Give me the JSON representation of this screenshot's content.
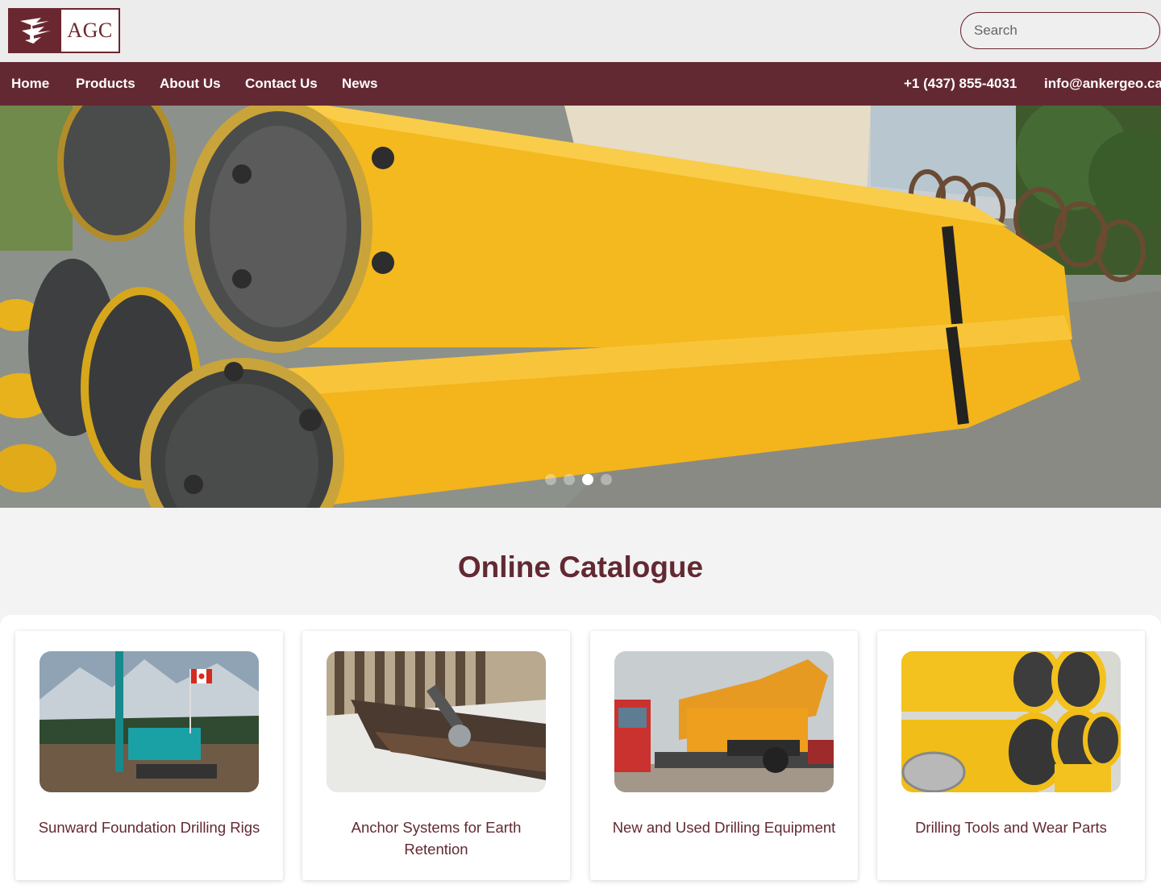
{
  "header": {
    "logo_text": "AGC",
    "search_placeholder": "Search"
  },
  "nav": {
    "items": [
      {
        "label": "Home"
      },
      {
        "label": "Products"
      },
      {
        "label": "About Us"
      },
      {
        "label": "Contact Us"
      },
      {
        "label": "News"
      }
    ],
    "phone": "+1 (437) 855-4031",
    "email": "info@ankergeo.ca"
  },
  "hero": {
    "slide_count": 4,
    "active_slide": 3
  },
  "catalogue": {
    "title": "Online Catalogue",
    "cards": [
      {
        "title": "Sunward Foundation Drilling Rigs"
      },
      {
        "title": "Anchor Systems for Earth Retention"
      },
      {
        "title": "New and Used Drilling Equipment"
      },
      {
        "title": "Drilling Tools and Wear Parts"
      }
    ]
  },
  "colors": {
    "brand": "#632932",
    "accent_yellow": "#f2b81f"
  }
}
